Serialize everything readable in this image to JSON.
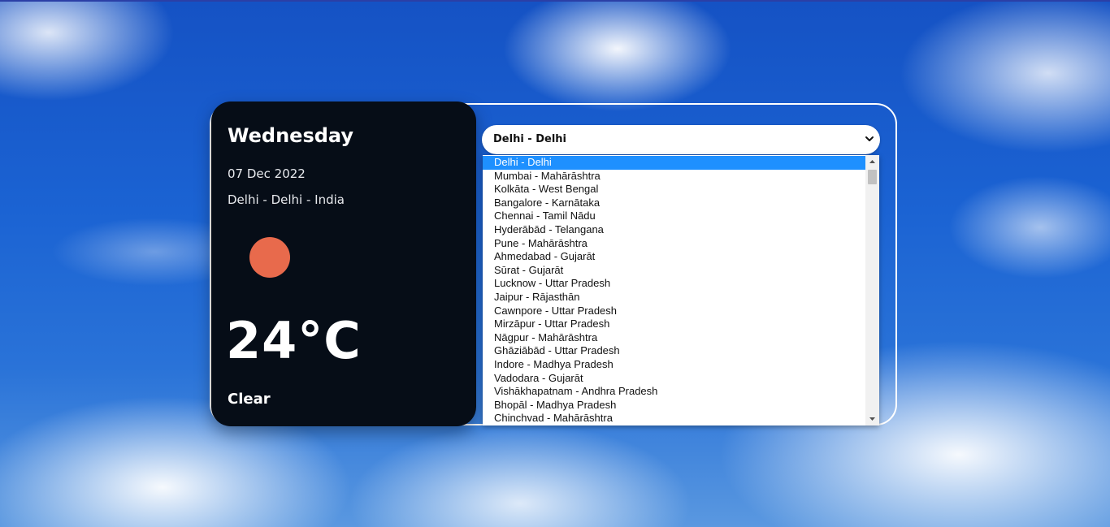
{
  "weather": {
    "day": "Wednesday",
    "date": "07 Dec 2022",
    "location": "Delhi - Delhi - India",
    "temperature": "24°C",
    "condition": "Clear",
    "icon": "sun-icon"
  },
  "city_select": {
    "selected": "Delhi - Delhi",
    "icon": "chevron-down-icon",
    "options": [
      "Delhi - Delhi",
      "Mumbai - Mahārāshtra",
      "Kolkāta - West Bengal",
      "Bangalore - Karnātaka",
      "Chennai - Tamil Nādu",
      "Hyderābād - Telangana",
      "Pune - Mahārāshtra",
      "Ahmedabad - Gujarāt",
      "Sūrat - Gujarāt",
      "Lucknow - Uttar Pradesh",
      "Jaipur - Rājasthān",
      "Cawnpore - Uttar Pradesh",
      "Mirzāpur - Uttar Pradesh",
      "Nāgpur - Mahārāshtra",
      "Ghāziābād - Uttar Pradesh",
      "Indore - Madhya Pradesh",
      "Vadodara - Gujarāt",
      "Vishākhapatnam - Andhra Pradesh",
      "Bhopāl - Madhya Pradesh",
      "Chinchvad - Mahārāshtra"
    ]
  },
  "colors": {
    "card_bg": "#060d17",
    "sun": "#e86a4c",
    "selection": "#1e90ff"
  }
}
